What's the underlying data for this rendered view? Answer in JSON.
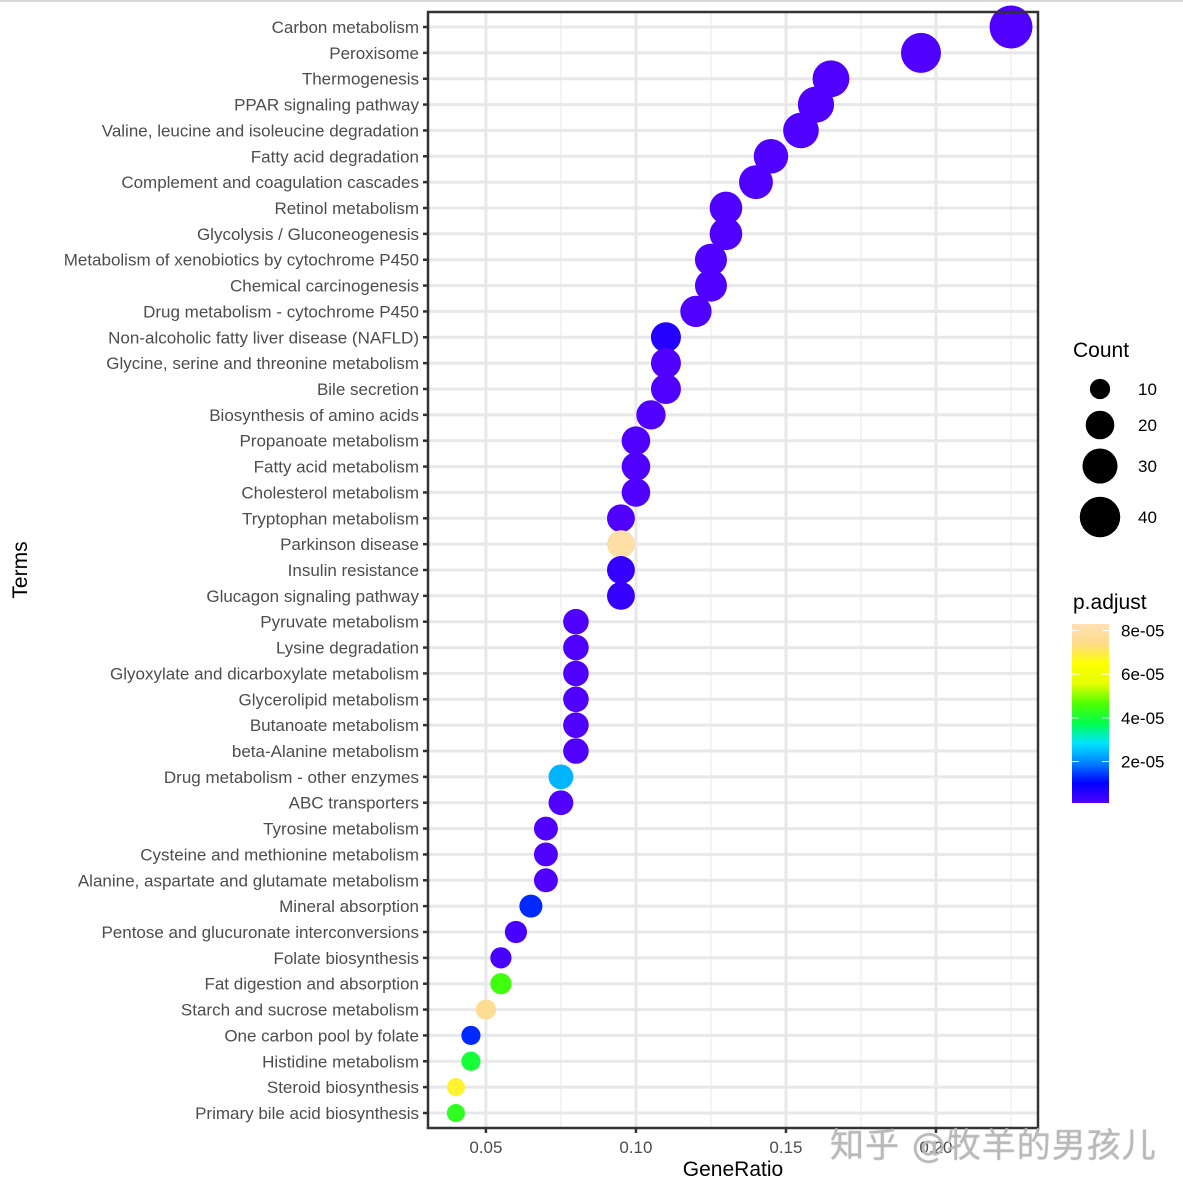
{
  "watermark": "知乎 @牧羊的男孩儿",
  "chart_data": {
    "type": "scatter",
    "subtype": "dotplot",
    "title": "",
    "xlabel": "GeneRatio",
    "ylabel": "Terms",
    "xlim": [
      0.0307,
      0.234
    ],
    "xticks": [
      0.05,
      0.1,
      0.15,
      0.2
    ],
    "xtick_labels": [
      "0.05",
      "0.10",
      "0.15",
      "0.20"
    ],
    "grid": true,
    "legend_placement": "right",
    "size_legend": {
      "title": "Count",
      "values": [
        10,
        20,
        30,
        40
      ],
      "labels": [
        "10",
        "20",
        "30",
        "40"
      ]
    },
    "color_legend": {
      "title": "p.adjust",
      "range": [
        1e-06,
        8.3e-05
      ],
      "ticks": [
        2e-05,
        4e-05,
        6e-05,
        8e-05
      ],
      "tick_labels": [
        "2e-05",
        "4e-05",
        "6e-05",
        "8e-05"
      ],
      "colormap": [
        "#5000FF",
        "#0000FF",
        "#0080FF",
        "#00E5FF",
        "#00FF4D",
        "#4DFF00",
        "#E6FF00",
        "#FFFF00",
        "#FFDB8A",
        "#FFE0B3"
      ]
    },
    "points": [
      {
        "term": "Carbon metabolism",
        "gene_ratio": 0.225,
        "count": 45,
        "p_adjust": 1e-06
      },
      {
        "term": "Peroxisome",
        "gene_ratio": 0.195,
        "count": 39,
        "p_adjust": 1e-06
      },
      {
        "term": "Thermogenesis",
        "gene_ratio": 0.165,
        "count": 33,
        "p_adjust": 1e-06
      },
      {
        "term": "PPAR signaling pathway",
        "gene_ratio": 0.16,
        "count": 32,
        "p_adjust": 1e-06
      },
      {
        "term": "Valine, leucine and isoleucine degradation",
        "gene_ratio": 0.155,
        "count": 31,
        "p_adjust": 1e-06
      },
      {
        "term": "Fatty acid degradation",
        "gene_ratio": 0.145,
        "count": 29,
        "p_adjust": 1e-06
      },
      {
        "term": "Complement and coagulation cascades",
        "gene_ratio": 0.14,
        "count": 28,
        "p_adjust": 1e-06
      },
      {
        "term": "Retinol metabolism",
        "gene_ratio": 0.13,
        "count": 26,
        "p_adjust": 1e-06
      },
      {
        "term": "Glycolysis / Gluconeogenesis",
        "gene_ratio": 0.13,
        "count": 26,
        "p_adjust": 1e-06
      },
      {
        "term": "Metabolism of xenobiotics by cytochrome P450",
        "gene_ratio": 0.125,
        "count": 25,
        "p_adjust": 1e-06
      },
      {
        "term": "Chemical carcinogenesis",
        "gene_ratio": 0.125,
        "count": 25,
        "p_adjust": 1e-06
      },
      {
        "term": "Drug metabolism - cytochrome P450",
        "gene_ratio": 0.12,
        "count": 24,
        "p_adjust": 1e-06
      },
      {
        "term": "Non-alcoholic fatty liver disease (NAFLD)",
        "gene_ratio": 0.11,
        "count": 22,
        "p_adjust": 6e-06
      },
      {
        "term": "Glycine, serine and threonine metabolism",
        "gene_ratio": 0.11,
        "count": 22,
        "p_adjust": 1e-06
      },
      {
        "term": "Bile secretion",
        "gene_ratio": 0.11,
        "count": 22,
        "p_adjust": 1e-06
      },
      {
        "term": "Biosynthesis of amino acids",
        "gene_ratio": 0.105,
        "count": 21,
        "p_adjust": 1e-06
      },
      {
        "term": "Propanoate metabolism",
        "gene_ratio": 0.1,
        "count": 20,
        "p_adjust": 1e-06
      },
      {
        "term": "Fatty acid metabolism",
        "gene_ratio": 0.1,
        "count": 20,
        "p_adjust": 1e-06
      },
      {
        "term": "Cholesterol metabolism",
        "gene_ratio": 0.1,
        "count": 20,
        "p_adjust": 1e-06
      },
      {
        "term": "Tryptophan metabolism",
        "gene_ratio": 0.095,
        "count": 19,
        "p_adjust": 1e-06
      },
      {
        "term": "Parkinson disease",
        "gene_ratio": 0.095,
        "count": 19,
        "p_adjust": 8e-05
      },
      {
        "term": "Insulin resistance",
        "gene_ratio": 0.095,
        "count": 19,
        "p_adjust": 4e-06
      },
      {
        "term": "Glucagon signaling pathway",
        "gene_ratio": 0.095,
        "count": 19,
        "p_adjust": 4e-06
      },
      {
        "term": "Pyruvate metabolism",
        "gene_ratio": 0.08,
        "count": 16,
        "p_adjust": 1e-06
      },
      {
        "term": "Lysine degradation",
        "gene_ratio": 0.08,
        "count": 16,
        "p_adjust": 1e-06
      },
      {
        "term": "Glyoxylate and dicarboxylate metabolism",
        "gene_ratio": 0.08,
        "count": 16,
        "p_adjust": 1e-06
      },
      {
        "term": "Glycerolipid metabolism",
        "gene_ratio": 0.08,
        "count": 16,
        "p_adjust": 1e-06
      },
      {
        "term": "Butanoate metabolism",
        "gene_ratio": 0.08,
        "count": 16,
        "p_adjust": 1e-06
      },
      {
        "term": "beta-Alanine metabolism",
        "gene_ratio": 0.08,
        "count": 16,
        "p_adjust": 1e-06
      },
      {
        "term": "Drug metabolism - other enzymes",
        "gene_ratio": 0.075,
        "count": 15,
        "p_adjust": 2.4e-05
      },
      {
        "term": "ABC transporters",
        "gene_ratio": 0.075,
        "count": 15,
        "p_adjust": 1e-06
      },
      {
        "term": "Tyrosine metabolism",
        "gene_ratio": 0.07,
        "count": 14,
        "p_adjust": 1e-06
      },
      {
        "term": "Cysteine and methionine metabolism",
        "gene_ratio": 0.07,
        "count": 14,
        "p_adjust": 1e-06
      },
      {
        "term": "Alanine, aspartate and glutamate metabolism",
        "gene_ratio": 0.07,
        "count": 14,
        "p_adjust": 1e-06
      },
      {
        "term": "Mineral absorption",
        "gene_ratio": 0.065,
        "count": 13,
        "p_adjust": 1.3e-05
      },
      {
        "term": "Pentose and glucuronate interconversions",
        "gene_ratio": 0.06,
        "count": 12,
        "p_adjust": 2e-06
      },
      {
        "term": "Folate biosynthesis",
        "gene_ratio": 0.055,
        "count": 11,
        "p_adjust": 2e-06
      },
      {
        "term": "Fat digestion and absorption",
        "gene_ratio": 0.055,
        "count": 11,
        "p_adjust": 4.5e-05
      },
      {
        "term": "Starch and sucrose metabolism",
        "gene_ratio": 0.05,
        "count": 10,
        "p_adjust": 7.6e-05
      },
      {
        "term": "One carbon pool by folate",
        "gene_ratio": 0.045,
        "count": 9,
        "p_adjust": 1.3e-05
      },
      {
        "term": "Histidine metabolism",
        "gene_ratio": 0.045,
        "count": 9,
        "p_adjust": 4e-05
      },
      {
        "term": "Steroid biosynthesis",
        "gene_ratio": 0.04,
        "count": 8,
        "p_adjust": 6.8e-05
      },
      {
        "term": "Primary bile acid biosynthesis",
        "gene_ratio": 0.04,
        "count": 8,
        "p_adjust": 4.3e-05
      }
    ]
  }
}
